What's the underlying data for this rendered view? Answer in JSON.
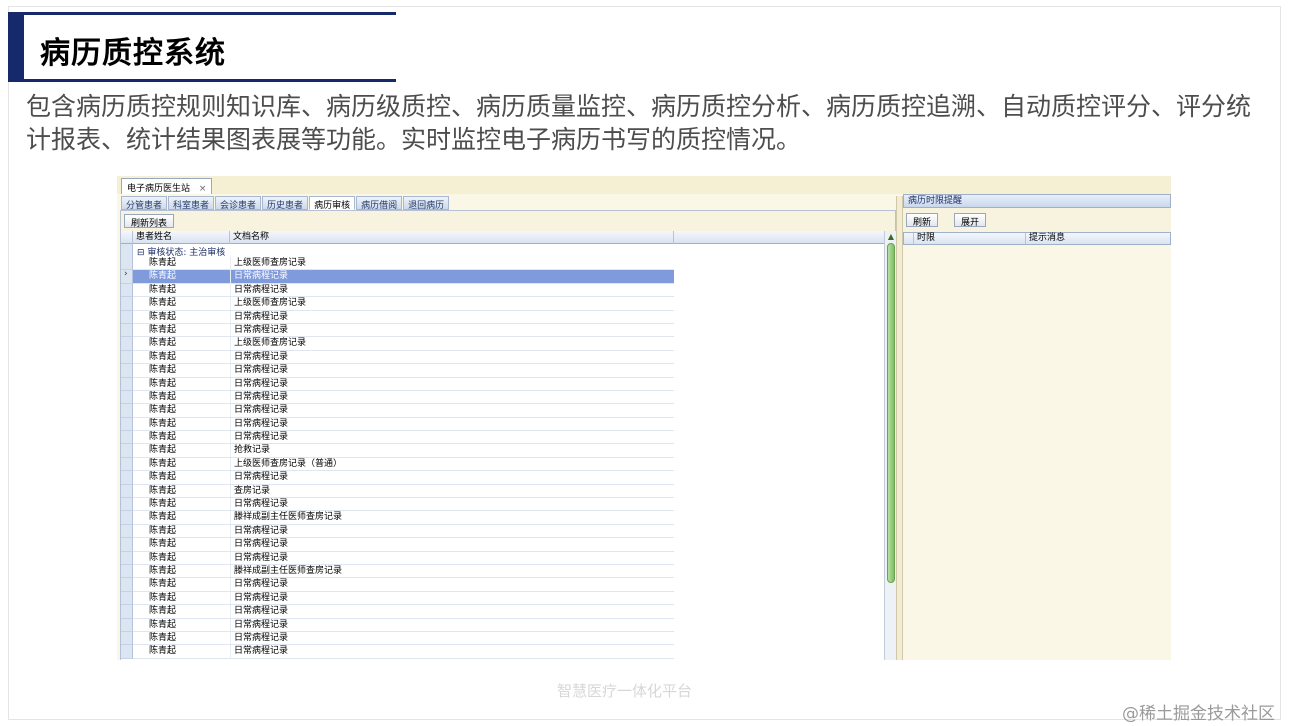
{
  "slide": {
    "title": "病历质控系统",
    "description": "包含病历质控规则知识库、病历级质控、病历质量监控、病历质控分析、病历质控追溯、自动质控评分、评分统计报表、统计结果图表展等功能。实时监控电子病历书写的质控情况。"
  },
  "app": {
    "window_tab": "电子病历医生站",
    "window_tab_close": "×",
    "subtabs": [
      "分管患者",
      "科室患者",
      "会诊患者",
      "历史患者",
      "病历审核",
      "病历借阅",
      "退回病历"
    ],
    "active_subtab": "病历审核",
    "refresh_list_button": "刷新列表",
    "grid": {
      "columns": [
        "患者姓名",
        "文档名称"
      ],
      "group_label": "审核状态: 主治审核",
      "rows": [
        {
          "patient": "陈青起",
          "doc": "上级医师查房记录"
        },
        {
          "patient": "陈青起",
          "doc": "日常病程记录",
          "selected": true
        },
        {
          "patient": "陈青起",
          "doc": "日常病程记录"
        },
        {
          "patient": "陈青起",
          "doc": "上级医师查房记录"
        },
        {
          "patient": "陈青起",
          "doc": "日常病程记录"
        },
        {
          "patient": "陈青起",
          "doc": "日常病程记录"
        },
        {
          "patient": "陈青起",
          "doc": "上级医师查房记录"
        },
        {
          "patient": "陈青起",
          "doc": "日常病程记录"
        },
        {
          "patient": "陈青起",
          "doc": "日常病程记录"
        },
        {
          "patient": "陈青起",
          "doc": "日常病程记录"
        },
        {
          "patient": "陈青起",
          "doc": "日常病程记录"
        },
        {
          "patient": "陈青起",
          "doc": "日常病程记录"
        },
        {
          "patient": "陈青起",
          "doc": "日常病程记录"
        },
        {
          "patient": "陈青起",
          "doc": "日常病程记录"
        },
        {
          "patient": "陈青起",
          "doc": "抢救记录"
        },
        {
          "patient": "陈青起",
          "doc": "上级医师查房记录（普通）"
        },
        {
          "patient": "陈青起",
          "doc": "日常病程记录"
        },
        {
          "patient": "陈青起",
          "doc": "查房记录"
        },
        {
          "patient": "陈青起",
          "doc": "日常病程记录"
        },
        {
          "patient": "陈青起",
          "doc": "滕祥成副主任医师查房记录"
        },
        {
          "patient": "陈青起",
          "doc": "日常病程记录"
        },
        {
          "patient": "陈青起",
          "doc": "日常病程记录"
        },
        {
          "patient": "陈青起",
          "doc": "日常病程记录"
        },
        {
          "patient": "陈青起",
          "doc": "滕祥成副主任医师查房记录"
        },
        {
          "patient": "陈青起",
          "doc": "日常病程记录"
        },
        {
          "patient": "陈青起",
          "doc": "日常病程记录"
        },
        {
          "patient": "陈青起",
          "doc": "日常病程记录"
        },
        {
          "patient": "陈青起",
          "doc": "日常病程记录"
        },
        {
          "patient": "陈青起",
          "doc": "日常病程记录"
        },
        {
          "patient": "陈青起",
          "doc": "日常病程记录"
        }
      ]
    },
    "right_panel": {
      "title": "病历时限提醒",
      "refresh_button": "刷新",
      "expand_button": "展开",
      "columns": [
        "时限",
        "提示消息"
      ]
    }
  },
  "watermarks": {
    "center": "智慧医疗一体化平台",
    "corner": "@稀土掘金技术社区"
  },
  "colors": {
    "title_bar": "#15296b",
    "selected_row": "#7f9bdc",
    "scrollbar_thumb": "#7cbf5f"
  }
}
